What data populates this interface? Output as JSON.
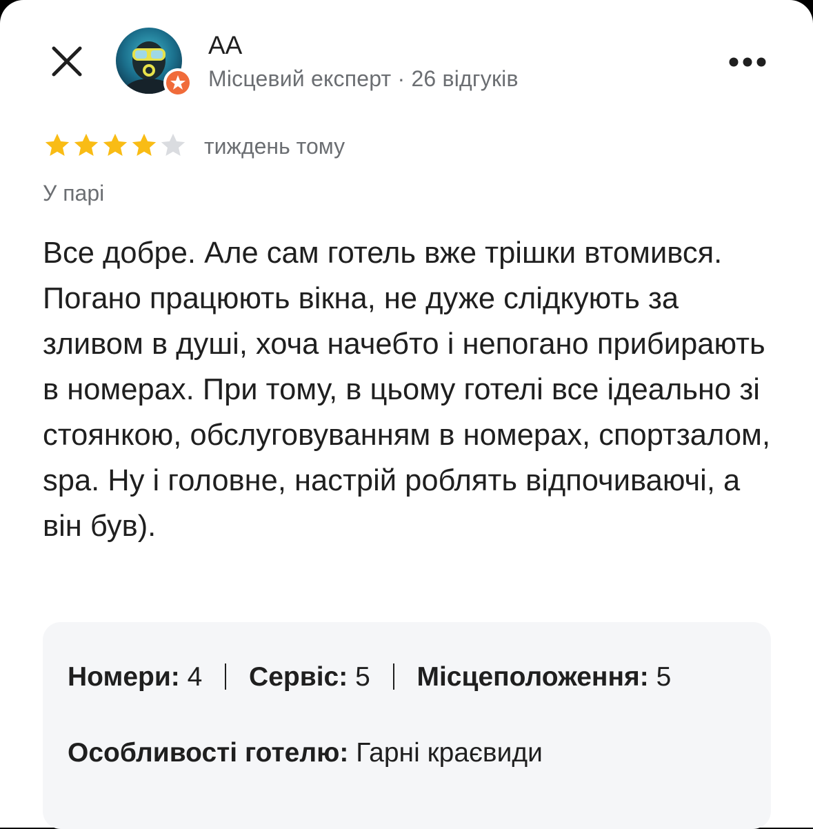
{
  "review": {
    "author": {
      "name": "АА",
      "meta": "Місцевий експерт · 26 відгуків"
    },
    "rating": 4,
    "max_rating": 5,
    "time": "тиждень тому",
    "trip_type": "У парі",
    "text": "Все добре. Але сам готель вже трішки втомився. Погано працюють вікна, не дуже слідкують за зливом в душі, хоча начебто і непогано прибирають в номерах. При тому, в цьому готелі все ідеально зі стоянкою, обслуговуванням в номерах, спортзалом, spa. Ну і головне, настрій роблять відпочиваючі, а він був).",
    "sub_ratings": {
      "rooms_label": "Номери:",
      "rooms_value": "4",
      "service_label": "Сервіс:",
      "service_value": "5",
      "location_label": "Місцеположення:",
      "location_value": "5"
    },
    "features": {
      "label": "Особливості готелю:",
      "value": "Гарні краєвиди"
    }
  },
  "colors": {
    "star_filled": "#F9BC15",
    "star_empty": "#DADCE0",
    "badge": "#F06B3A",
    "secondary_text": "#6B6E72",
    "primary_text": "#1F1F1F",
    "card_bg": "#F5F6F8"
  },
  "icons": {
    "close": "close-icon",
    "more": "more-horizontal-icon",
    "badge": "local-guide-star-icon"
  }
}
